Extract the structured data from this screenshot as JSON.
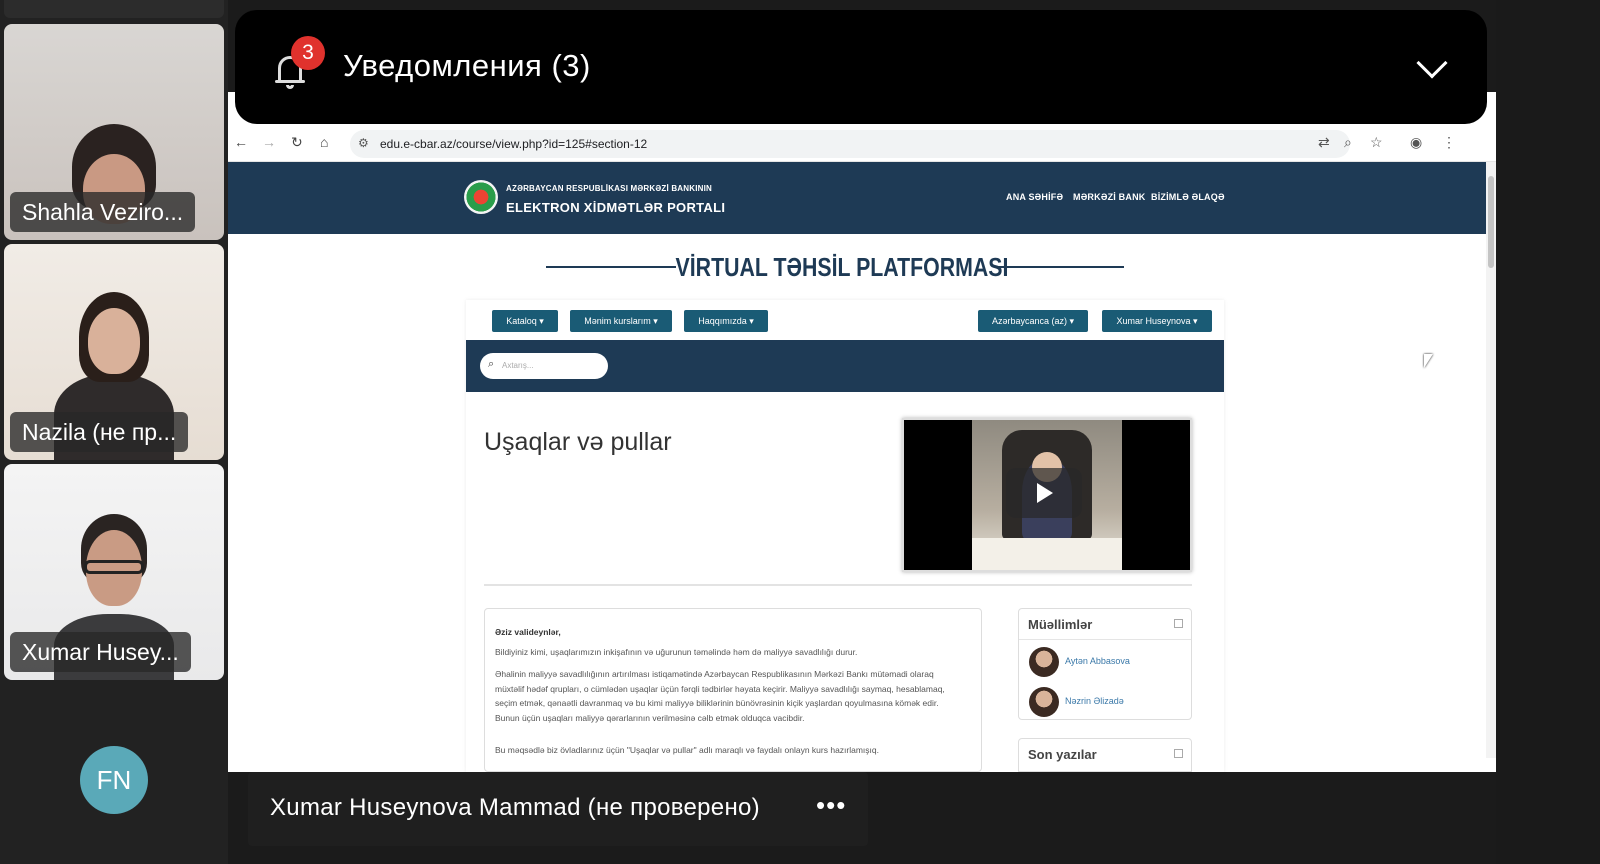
{
  "participants": [
    {
      "name": "Shahla Veziro..."
    },
    {
      "name": "Nazila (не пр..."
    },
    {
      "name": "Xumar Husey..."
    }
  ],
  "avatar_initials": "FN",
  "notification": {
    "badge": "3",
    "title": "Уведомления (3)"
  },
  "browser": {
    "url": "edu.e-cbar.az/course/view.php?id=125#section-12"
  },
  "site": {
    "logo_small": "AZƏRBAYCAN RESPUBLİKASI MƏRKƏZİ BANKININ",
    "logo_big": "ELEKTRON XİDMƏTLƏR PORTALI",
    "nav": [
      "ANA SƏHİFƏ",
      "MƏRKƏZİ BANK",
      "BİZİMLƏ ƏLAQƏ"
    ],
    "platform_title": "VİRTUAL TƏHSİL PLATFORMASI"
  },
  "course": {
    "menus": [
      "Kataloq ▾",
      "Mənim kurslarım ▾",
      "Haqqımızda ▾"
    ],
    "language": "Azərbaycanca (az) ▾",
    "user_menu": "Xumar Huseynova ▾",
    "search_placeholder": "Axtarış...",
    "title": "Uşaqlar və pullar",
    "intro": {
      "greeting": "Əziz valideynlər,",
      "p1": "Bildiyiniz kimi, uşaqlarımızın inkişafının və uğurunun təməlində həm də maliyyə savadlılığı durur.",
      "p2": "Əhalinin maliyyə savadlılığının artırılması istiqamətində Azərbaycan Respublikasının Mərkəzi Bankı mütəmadi olaraq müxtəlif hədəf qrupları, o cümlədən uşaqlar üçün fərqli tədbirlər həyata keçirir. Maliyyə savadlılığı saymaq, hesablamaq, seçim etmək, qənaətli davranmaq və bu kimi maliyyə biliklərinin bünövrəsinin kiçik yaşlardan qoyulmasına kömək edir. Bunun üçün uşaqları maliyyə qərarlarının verilməsinə cəlb etmək olduqca vacibdir.",
      "p3": "Bu məqsədlə biz övladlarınız üçün \"Uşaqlar və pullar\" adlı maraqlı və faydalı onlayn kurs hazırlamışıq."
    },
    "teachers_header": "Müəllimlər",
    "teachers": [
      "Aytən Abbasova",
      "Nəzrin Əlizadə"
    ],
    "recent_header": "Son yazılar"
  },
  "speaker": {
    "name": "Xumar Huseynova Mammad (не проверено)",
    "more": "•••"
  },
  "colors": {
    "site_navy": "#1e3a55",
    "button_teal": "#1a5b75",
    "badge_red": "#e0322d",
    "avatar_teal": "#5aa9b8"
  }
}
